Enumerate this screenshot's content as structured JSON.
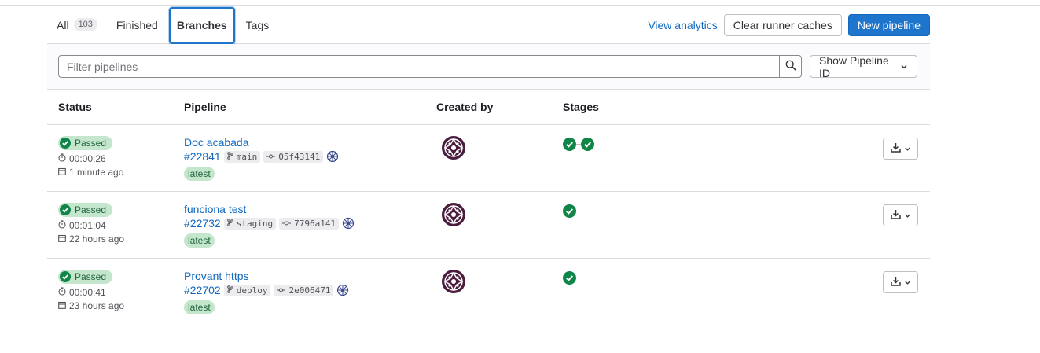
{
  "tabs": [
    {
      "label": "All",
      "count": "103"
    },
    {
      "label": "Finished"
    },
    {
      "label": "Branches"
    },
    {
      "label": "Tags"
    }
  ],
  "actions": {
    "view_analytics": "View analytics",
    "clear_caches": "Clear runner caches",
    "new_pipeline": "New pipeline"
  },
  "filter": {
    "placeholder": "Filter pipelines",
    "id_select": "Show Pipeline ID"
  },
  "table": {
    "headers": {
      "status": "Status",
      "pipeline": "Pipeline",
      "created_by": "Created by",
      "stages": "Stages"
    },
    "rows": [
      {
        "status": "Passed",
        "duration": "00:00:26",
        "finished": "1 minute ago",
        "title": "Doc acabada",
        "id": "#22841",
        "ref": "main",
        "commit": "05f43141",
        "tag": "latest",
        "stages": 2
      },
      {
        "status": "Passed",
        "duration": "00:01:04",
        "finished": "22 hours ago",
        "title": "funciona test",
        "id": "#22732",
        "ref": "staging",
        "commit": "7796a141",
        "tag": "latest",
        "stages": 1
      },
      {
        "status": "Passed",
        "duration": "00:00:41",
        "finished": "23 hours ago",
        "title": "Provant https",
        "id": "#22702",
        "ref": "deploy",
        "commit": "2e006471",
        "tag": "latest",
        "stages": 1
      }
    ]
  },
  "colors": {
    "accent": "#1f75cb",
    "success": "#108548",
    "avatar": "#4a1d3f"
  }
}
